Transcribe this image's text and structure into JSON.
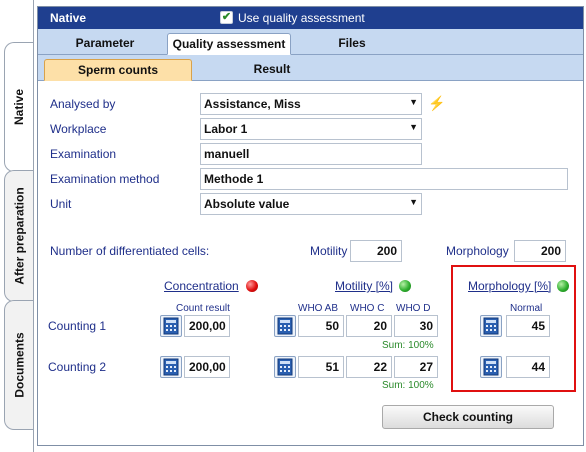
{
  "side_tabs": [
    "Native",
    "After preparation",
    "Documents"
  ],
  "header": {
    "title": "Native",
    "use_quality_label": "Use quality assessment",
    "use_quality_checked": true
  },
  "tabs_top": [
    "Parameter",
    "Quality assessment",
    "Files"
  ],
  "tabs_sub": [
    "Sperm counts",
    "Result"
  ],
  "form": {
    "analysed_by_label": "Analysed by",
    "analysed_by_value": "Assistance, Miss",
    "workplace_label": "Workplace",
    "workplace_value": "Labor 1",
    "examination_label": "Examination",
    "examination_value": "manuell",
    "exam_method_label": "Examination method",
    "exam_method_value": "Methode 1",
    "unit_label": "Unit",
    "unit_value": "Absolute value"
  },
  "differentiated": {
    "label": "Number of differentiated cells:",
    "motility_label": "Motility",
    "motility_value": "200",
    "morphology_label": "Morphology",
    "morphology_value": "200"
  },
  "sections": {
    "concentration": "Concentration",
    "motility": "Motility [%]",
    "morphology": "Morphology [%]",
    "count_result": "Count result",
    "who_ab": "WHO AB",
    "who_c": "WHO C",
    "who_d": "WHO  D",
    "normal": "Normal",
    "status_colors": {
      "concentration": "#e01010",
      "motility": "#30b030",
      "morphology": "#30b030"
    }
  },
  "countings": [
    {
      "label": "Counting 1",
      "concentration": "200,00",
      "who_ab": "50",
      "who_c": "20",
      "who_d": "30",
      "sum": "Sum: 100%",
      "normal": "45"
    },
    {
      "label": "Counting 2",
      "concentration": "200,00",
      "who_ab": "51",
      "who_c": "22",
      "who_d": "27",
      "sum": "Sum: 100%",
      "normal": "44"
    }
  ],
  "actions": {
    "check_counting": "Check counting"
  },
  "icons": {
    "lightning": "lightning-icon",
    "calculator": "calculator-icon",
    "dropdown": "chevron-down-icon",
    "checkbox": "checkbox-checked-icon"
  }
}
